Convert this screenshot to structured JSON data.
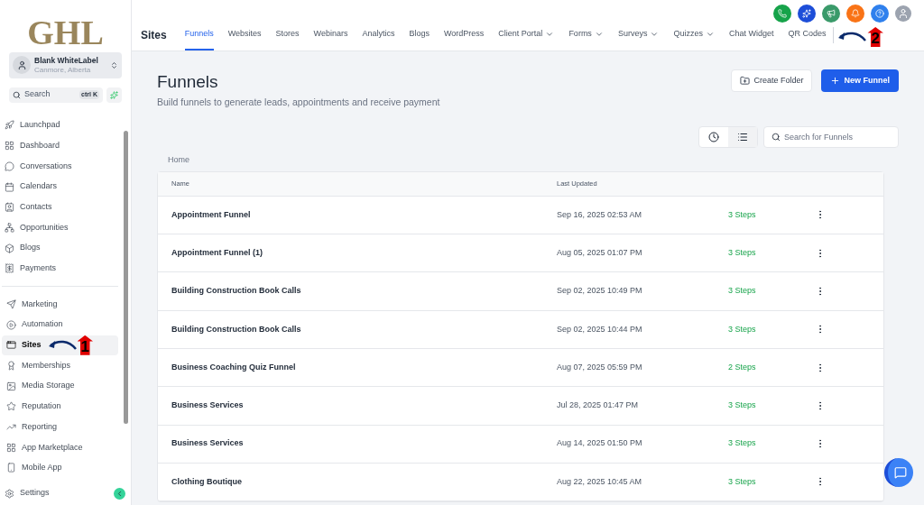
{
  "logo": "GHL",
  "account": {
    "name": "Blank WhiteLabel",
    "location": "Canmore, Alberta"
  },
  "search": {
    "placeholder": "Search",
    "shortcut": "ctrl K"
  },
  "sidebar": {
    "groups": [
      {
        "items": [
          {
            "label": "Launchpad",
            "selected": false
          },
          {
            "label": "Dashboard",
            "selected": false
          },
          {
            "label": "Conversations",
            "selected": false
          },
          {
            "label": "Calendars",
            "selected": false
          },
          {
            "label": "Contacts",
            "selected": false
          },
          {
            "label": "Opportunities",
            "selected": false
          },
          {
            "label": "Blogs",
            "selected": false
          },
          {
            "label": "Payments",
            "selected": false
          }
        ]
      },
      {
        "items": [
          {
            "label": "Marketing",
            "selected": false
          },
          {
            "label": "Automation",
            "selected": false
          },
          {
            "label": "Sites",
            "selected": true
          },
          {
            "label": "Memberships",
            "selected": false
          },
          {
            "label": "Media Storage",
            "selected": false
          },
          {
            "label": "Reputation",
            "selected": false
          },
          {
            "label": "Reporting",
            "selected": false
          },
          {
            "label": "App Marketplace",
            "selected": false
          },
          {
            "label": "Mobile App",
            "selected": false
          }
        ]
      }
    ],
    "settings": "Settings"
  },
  "section_title": "Sites",
  "tabs": [
    {
      "label": "Funnels",
      "selected": true,
      "dropdown": false
    },
    {
      "label": "Websites",
      "selected": false,
      "dropdown": false
    },
    {
      "label": "Stores",
      "selected": false,
      "dropdown": false
    },
    {
      "label": "Webinars",
      "selected": false,
      "dropdown": false
    },
    {
      "label": "Analytics",
      "selected": false,
      "dropdown": false
    },
    {
      "label": "Blogs",
      "selected": false,
      "dropdown": false
    },
    {
      "label": "WordPress",
      "selected": false,
      "dropdown": false
    },
    {
      "label": "Client Portal",
      "selected": false,
      "dropdown": true
    },
    {
      "label": "Forms",
      "selected": false,
      "dropdown": true
    },
    {
      "label": "Surveys",
      "selected": false,
      "dropdown": true
    },
    {
      "label": "Quizzes",
      "selected": false,
      "dropdown": true
    },
    {
      "label": "Chat Widget",
      "selected": false,
      "dropdown": false
    },
    {
      "label": "QR Codes",
      "selected": false,
      "dropdown": false
    }
  ],
  "header_buttons": [
    {
      "color": "#16a34a"
    },
    {
      "color": "#1d4ed8"
    },
    {
      "color": "#3a9a6a"
    },
    {
      "color": "#f97316"
    },
    {
      "color": "#2f80ed"
    }
  ],
  "page": {
    "title": "Funnels",
    "subtitle": "Build funnels to generate leads, appointments and receive payment",
    "create_folder": "Create Folder",
    "new_funnel": "New Funnel",
    "search_placeholder": "Search for Funnels",
    "breadcrumb": "Home"
  },
  "table": {
    "columns": [
      "Name",
      "Last Updated"
    ],
    "rows": [
      {
        "name": "Appointment Funnel",
        "updated": "Sep 16, 2025 02:53 AM",
        "steps": "3 Steps"
      },
      {
        "name": "Appointment Funnel (1)",
        "updated": "Aug 05, 2025 01:07 PM",
        "steps": "3 Steps"
      },
      {
        "name": "Building Construction Book Calls",
        "updated": "Sep 02, 2025 10:49 PM",
        "steps": "3 Steps"
      },
      {
        "name": "Building Construction Book Calls",
        "updated": "Sep 02, 2025 10:44 PM",
        "steps": "3 Steps"
      },
      {
        "name": "Business Coaching Quiz Funnel",
        "updated": "Aug 07, 2025 05:59 PM",
        "steps": "2 Steps"
      },
      {
        "name": "Business Services",
        "updated": "Jul 28, 2025 01:47 PM",
        "steps": "3 Steps"
      },
      {
        "name": "Business Services",
        "updated": "Aug 14, 2025 01:50 PM",
        "steps": "3 Steps"
      },
      {
        "name": "Clothing Boutique",
        "updated": "Aug 22, 2025 10:45 AM",
        "steps": "3 Steps"
      }
    ]
  },
  "annotations": [
    {
      "label": "1"
    },
    {
      "label": "2"
    }
  ]
}
